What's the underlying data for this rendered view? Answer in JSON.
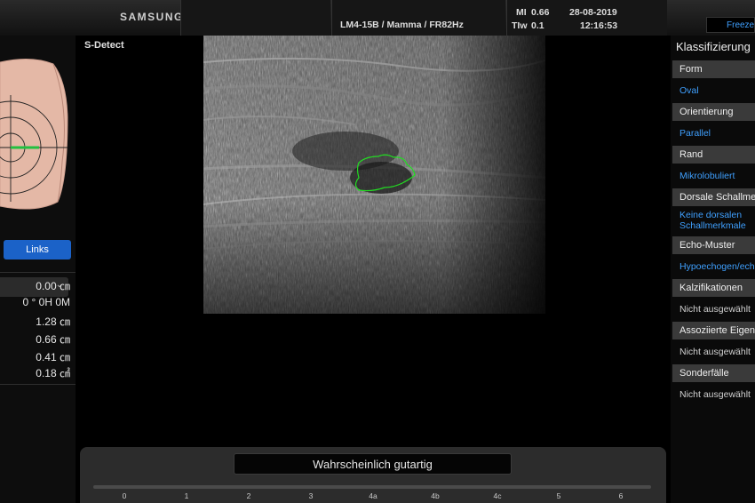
{
  "header": {
    "brand": "SAMSUNG",
    "probe": "LM4-15B / Mamma / FR82Hz",
    "mi_label": "MI",
    "mi_value": "0.66",
    "tiw_label": "TIw",
    "tiw_value": "0.1",
    "date": "28-08-2019",
    "time": "12:16:53",
    "freeze": "Freeze"
  },
  "left_panel": {
    "side_button": "Links",
    "measurements": [
      "0.00 ㎝",
      "0 ° 0H 0M",
      "1.28 ㎝",
      "0.66 ㎝",
      "0.41 ㎝",
      "0.18 ㎠"
    ]
  },
  "main": {
    "mode_label": "S-Detect",
    "result": "Wahrscheinlich gutartig",
    "scale_ticks": [
      "0",
      "1",
      "2",
      "3",
      "4a",
      "4b",
      "4c",
      "5",
      "6"
    ]
  },
  "right_panel": {
    "title": "Klassifizierung",
    "categories": [
      {
        "label": "Form",
        "value": "Oval",
        "selected": true
      },
      {
        "label": "Orientierung",
        "value": "Parallel",
        "selected": true
      },
      {
        "label": "Rand",
        "value": "Mikrolobuliert",
        "selected": true
      },
      {
        "label": "Dorsale Schallmerkmale",
        "value": "Keine dorsalen Schallmerkmale",
        "selected": true
      },
      {
        "label": "Echo-Muster",
        "value": "Hypoechogen/echogen",
        "selected": true
      },
      {
        "label": "Kalzifikationen",
        "value": "Nicht ausgewählt",
        "selected": false
      },
      {
        "label": "Assoziierte Eigenschaften",
        "value": "Nicht ausgewählt",
        "selected": false
      },
      {
        "label": "Sonderfälle",
        "value": "Nicht ausgewählt",
        "selected": false
      }
    ]
  },
  "colors": {
    "accent_blue": "#3fa0ff",
    "button_blue": "#1b62c8",
    "lesion_outline": "#22dd22"
  }
}
